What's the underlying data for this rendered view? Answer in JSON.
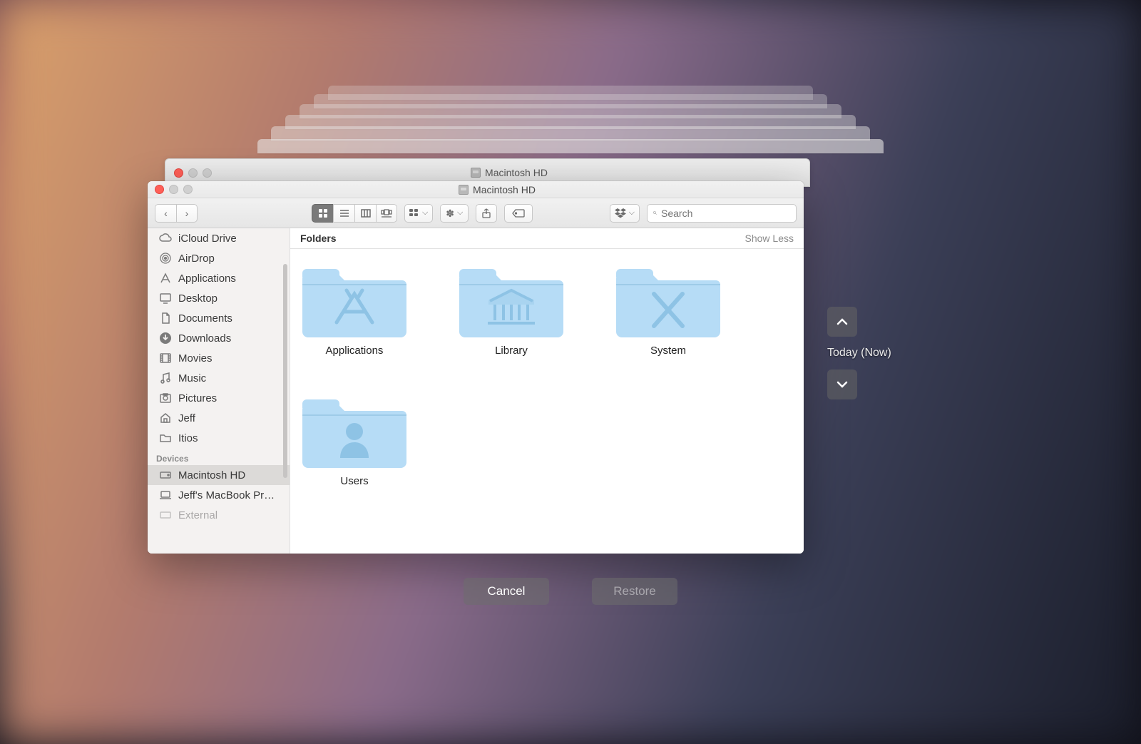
{
  "window": {
    "title": "Macintosh HD",
    "behind_title": "Macintosh HD"
  },
  "search": {
    "placeholder": "Search"
  },
  "sidebar": {
    "favorites": [
      {
        "label": "iCloud Drive",
        "icon": "cloud"
      },
      {
        "label": "AirDrop",
        "icon": "airdrop"
      },
      {
        "label": "Applications",
        "icon": "apps"
      },
      {
        "label": "Desktop",
        "icon": "desktop"
      },
      {
        "label": "Documents",
        "icon": "documents"
      },
      {
        "label": "Downloads",
        "icon": "downloads"
      },
      {
        "label": "Movies",
        "icon": "movies"
      },
      {
        "label": "Music",
        "icon": "music"
      },
      {
        "label": "Pictures",
        "icon": "pictures"
      },
      {
        "label": "Jeff",
        "icon": "home"
      },
      {
        "label": "Itios",
        "icon": "folder"
      }
    ],
    "devices_header": "Devices",
    "devices": [
      {
        "label": "Macintosh HD",
        "icon": "hd",
        "selected": true
      },
      {
        "label": "Jeff's MacBook Pr…",
        "icon": "laptop"
      },
      {
        "label": "External",
        "icon": "hd"
      }
    ]
  },
  "content": {
    "section_label": "Folders",
    "show_less": "Show Less",
    "folders": [
      {
        "label": "Applications",
        "glyph": "apps"
      },
      {
        "label": "Library",
        "glyph": "library"
      },
      {
        "label": "System",
        "glyph": "system"
      },
      {
        "label": "Users",
        "glyph": "users"
      }
    ]
  },
  "timeline": {
    "label": "Today (Now)"
  },
  "buttons": {
    "cancel": "Cancel",
    "restore": "Restore"
  }
}
